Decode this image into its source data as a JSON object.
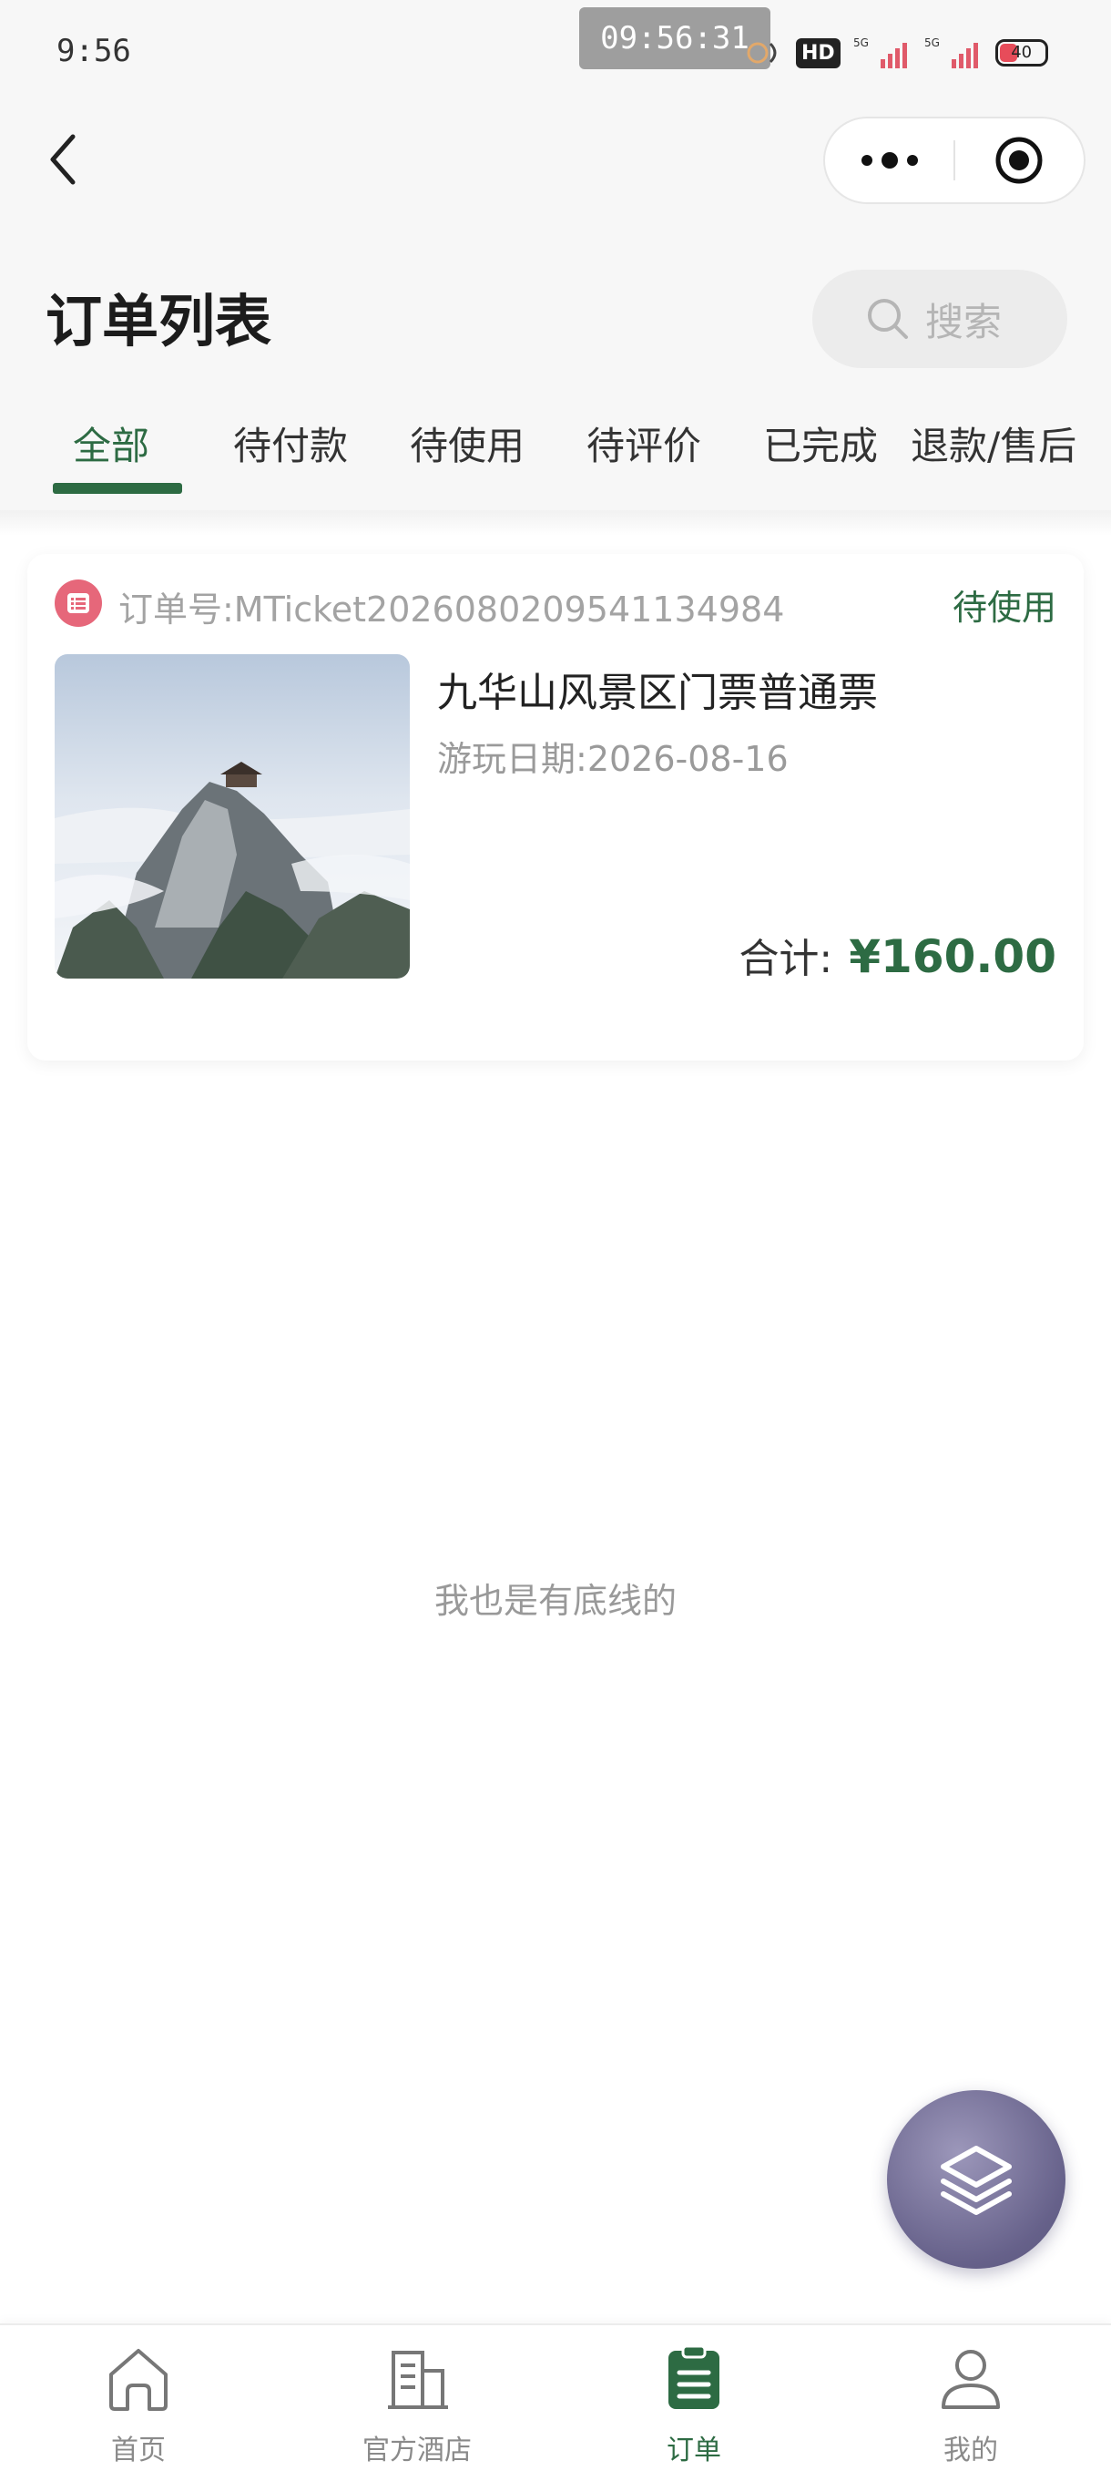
{
  "status_bar": {
    "time": "9:56",
    "recording_time": "09:56:31",
    "network_badge": "HD",
    "battery": "40",
    "battery_level_percent": 40
  },
  "nav": {
    "back_icon": "chevron-left-icon",
    "more_icon": "more-dots-icon",
    "close_icon": "target-close-icon"
  },
  "header": {
    "title": "订单列表",
    "search_placeholder": "搜索"
  },
  "tabs": [
    {
      "label": "全部",
      "active": true
    },
    {
      "label": "待付款",
      "active": false
    },
    {
      "label": "待使用",
      "active": false
    },
    {
      "label": "待评价",
      "active": false
    },
    {
      "label": "已完成",
      "active": false
    },
    {
      "label": "退款/售后",
      "active": false
    }
  ],
  "orders": [
    {
      "order_no": "订单号:MTicket2026080209541134984",
      "status": "待使用",
      "title": "九华山风景区门票普通票",
      "date_label": "游玩日期:",
      "date_value": "2026-08-16",
      "total_label": "合计:",
      "total_amount": "¥160.00"
    }
  ],
  "footer_text": "我也是有底线的",
  "tabbar": [
    {
      "label": "首页",
      "icon": "home-icon",
      "active": false
    },
    {
      "label": "官方酒店",
      "icon": "building-icon",
      "active": false
    },
    {
      "label": "订单",
      "icon": "clipboard-list-icon",
      "active": true
    },
    {
      "label": "我的",
      "icon": "user-icon",
      "active": false
    }
  ],
  "colors": {
    "accent": "#2d6b43",
    "order_icon": "#e6677a",
    "fab": "#66618a"
  }
}
